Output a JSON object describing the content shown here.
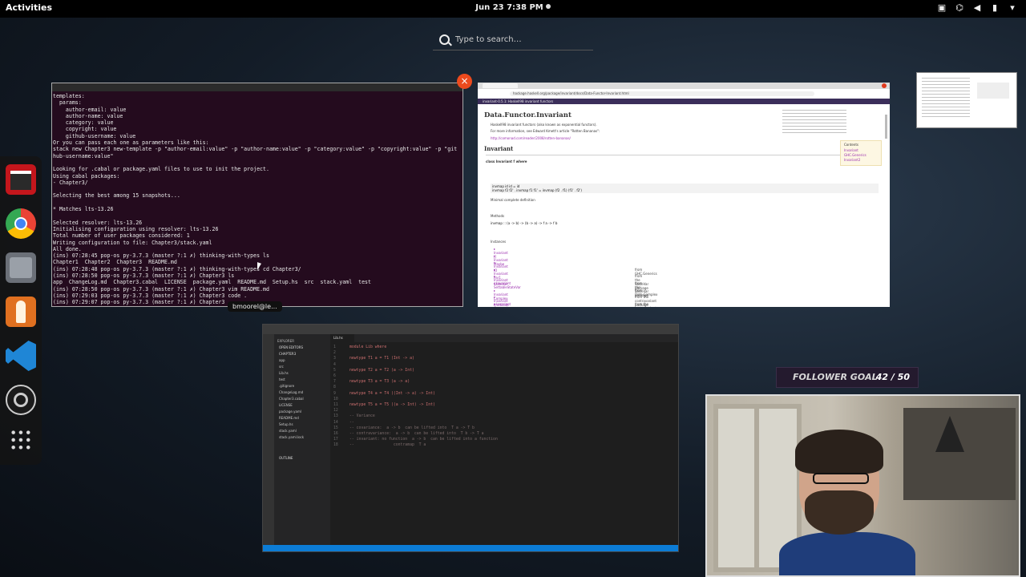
{
  "topbar": {
    "activities": "Activities",
    "clock": "Jun 23  7:38 PM"
  },
  "search": {
    "placeholder": "Type to search…"
  },
  "dock": {
    "apps": [
      "video-editor-icon",
      "chrome-icon",
      "files-icon",
      "installer-icon",
      "vscode-icon",
      "obs-icon",
      "app-grid-icon"
    ]
  },
  "terminal": {
    "title": "",
    "lines": [
      "templates:",
      "  params:",
      "    author-email: value",
      "    author-name: value",
      "    category: value",
      "    copyright: value",
      "    github-username: value",
      "Or you can pass each one as parameters like this:",
      "stack new Chapter3 new-template -p \"author-email:value\" -p \"author-name:value\" -p \"category:value\" -p \"copyright:value\" -p \"git",
      "hub-username:value\"",
      "",
      "Looking for .cabal or package.yaml files to use to init the project.",
      "Using cabal packages:",
      "- Chapter3/",
      "",
      "Selecting the best among 15 snapshots...",
      "",
      "* Matches lts-13.26",
      "",
      "Selected resolver: lts-13.26",
      "Initialising configuration using resolver: lts-13.26",
      "Total number of user packages considered: 1",
      "Writing configuration to file: Chapter3/stack.yaml",
      "All done.",
      "(ins) 07:28:45 pop-os py-3.7.3 (master ?:1 ✗) thinking-with-types ls",
      "Chapter1  Chapter2  Chapter3  README.md",
      "(ins) 07:28:48 pop-os py-3.7.3 (master ?:1 ✗) thinking-with-types cd Chapter3/",
      "(ins) 07:28:50 pop-os py-3.7.3 (master ?:1 ✗) Chapter3 ls",
      "app  ChangeLog.md  Chapter3.cabal  LICENSE  package.yaml  README.md  Setup.hs  src  stack.yaml  test",
      "(ins) 07:28:50 pop-os py-3.7.3 (master ?:1 ✗) Chapter3 vim README.md",
      "(ins) 07:29:03 pop-os py-3.7.3 (master ?:1 ✗) Chapter3 code .",
      "(ins) 07:29:07 pop-os py-3.7.3 (master ?:1 ✗) Chapter3"
    ],
    "tooltip": "bmoorel@le..."
  },
  "browser": {
    "url": "hackage.haskell.org/package/invariant/docs/Data-Functor-Invariant.html",
    "nav": "invariant-0.5.1: Haskell98 invariant functors",
    "title": "Data.Functor.Invariant",
    "desc1": "Haskell98 invariant functors (also known as exponential functors).",
    "desc2": "For more information, see Edward Kmett's article \"Rotten Bananas\":",
    "link": "http://comonad.com/reader/2008/rotten-bananas/",
    "section": "Invariant",
    "class_line": "class Invariant f where",
    "code1": "invmap id id = id",
    "code2": "invmap f2 f2' . invmap f1 f1' = invmap (f2 . f1) (f1' . f2')",
    "minimal": "Minimal complete definition",
    "methods": "Methods",
    "invmap": "invmap :: (a -> b) -> (b -> a) -> f a -> f b",
    "instances_label": "Instances",
    "instances": [
      "Invariant []",
      "Invariant Maybe",
      "Invariant IO",
      "Invariant Par1",
      "Invariant StateVar",
      "Invariant SettableStateVar",
      "Invariant Complex",
      "Invariant Predicate",
      "Invariant Comparison"
    ],
    "instance_notes": [
      "",
      "",
      "",
      "from GHC.Generics",
      "from the StateVar package",
      "from the StateVar package",
      "from Data.Complex",
      "from the contravariant package",
      "from the contravariant package"
    ],
    "contents": [
      "Contents",
      "Invariant",
      "GHC.Generics",
      "Invariant2"
    ]
  },
  "vscode": {
    "tab": "Lib.hs",
    "explorer": "EXPLORER",
    "open_editors": "OPEN EDITORS",
    "folder": "CHAPTER3",
    "files": [
      "app",
      "src",
      "Lib.hs",
      "test",
      ".gitignore",
      "ChangeLog.md",
      "Chapter3.cabal",
      "LICENSE",
      "package.yaml",
      "README.md",
      "Setup.hs",
      "stack.yaml",
      "stack.yaml.lock"
    ],
    "outline": "OUTLINE",
    "code": [
      "module Lib where",
      "",
      "newtype T1 a = T1 (Int -> a)",
      "",
      "newtype T2 a = T2 (a -> Int)",
      "",
      "newtype T3 a = T3 (a -> a)",
      "",
      "newtype T4 a = T4 ((Int -> a) -> Int)",
      "",
      "newtype T5 a = T5 ((a -> Int) -> Int)",
      "",
      "-- Variance",
      "--",
      "-- covariance:  a -> b  can be lifted into  T a -> T b",
      "-- contravariance:  a -> b  can be lifted into  T b -> T a",
      "-- invariant: no function  a -> b  can be lifted into a function",
      "--                 contramap  T a"
    ]
  },
  "follower_goal": {
    "label": "FOLLOWER GOAL",
    "count": "42 / 50"
  }
}
